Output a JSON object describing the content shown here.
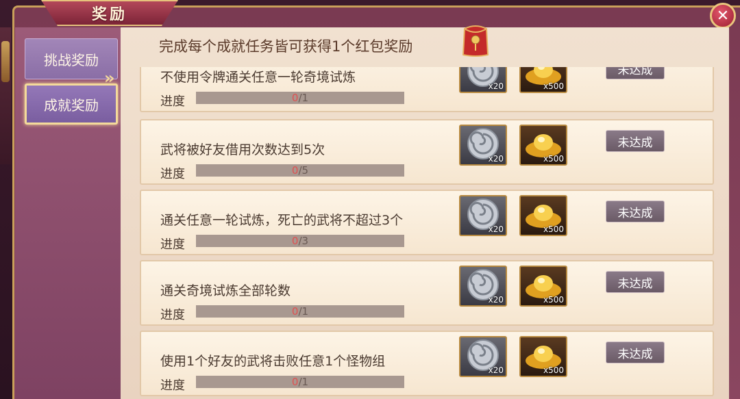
{
  "window": {
    "title": "奖励"
  },
  "sidebar": {
    "items": [
      {
        "label": "挑战奖励",
        "active": false
      },
      {
        "label": "成就奖励",
        "active": true
      }
    ]
  },
  "header": {
    "text": "完成每个成就任务皆可获得1个红包奖励"
  },
  "progress_label": "进度",
  "rewards": {
    "coin": {
      "icon": "silver-spiral-coin-icon",
      "qty": "x20"
    },
    "gold": {
      "icon": "gold-ingot-icon",
      "qty": "x500"
    }
  },
  "tasks": [
    {
      "title": "不使用令牌通关任意一轮奇境试炼",
      "current": "0",
      "total": "/1",
      "status": "未达成"
    },
    {
      "title": "武将被好友借用次数达到5次",
      "current": "0",
      "total": "/5",
      "status": "未达成"
    },
    {
      "title": "通关任意一轮试炼，死亡的武将不超过3个",
      "current": "0",
      "total": "/3",
      "status": "未达成"
    },
    {
      "title": "通关奇境试炼全部轮数",
      "current": "0",
      "total": "/1",
      "status": "未达成"
    },
    {
      "title": "使用1个好友的武将击败任意1个怪物组",
      "current": "0",
      "total": "/1",
      "status": "未达成"
    }
  ],
  "colors": {
    "accent": "#e6c37c",
    "progress_current": "#e05050",
    "frame": "#7a3a52"
  }
}
